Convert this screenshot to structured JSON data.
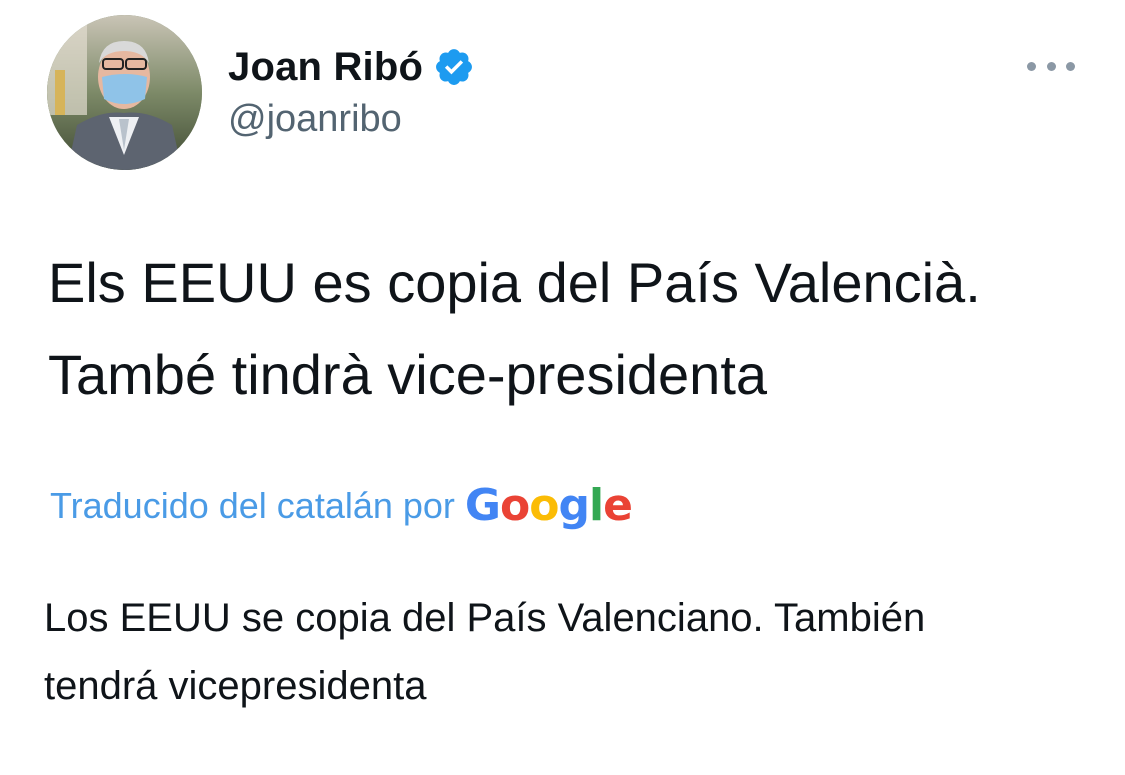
{
  "tweet": {
    "author": {
      "display_name": "Joan Ribó",
      "handle": "@joanribo",
      "verified": true,
      "avatar_icon": "profile-photo"
    },
    "more_icon": "ellipsis-icon",
    "text_lines": [
      "Els EEUU es copia del País Valencià.",
      "També tindrà vice-presidenta"
    ],
    "translation": {
      "label": "Traducido del catalán por",
      "provider": "Google",
      "text_lines": [
        "Los EEUU se copia del País Valenciano. También",
        "tendrá vicepresidenta"
      ]
    }
  },
  "colors": {
    "text_primary": "#0f1419",
    "text_secondary": "#536471",
    "link_blue": "#4a9be6",
    "verified_blue": "#1d9bf0"
  }
}
